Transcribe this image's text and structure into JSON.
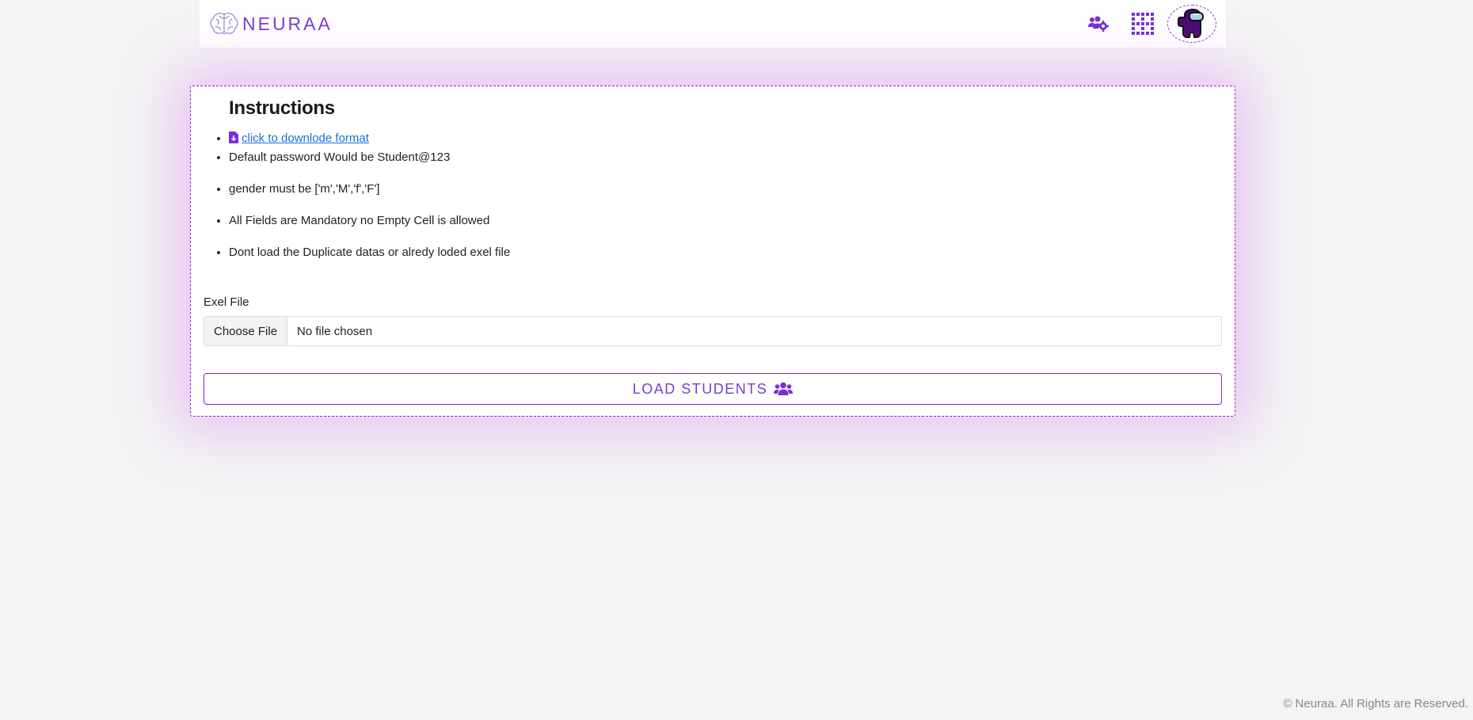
{
  "header": {
    "brand": "NEURAA",
    "icons": {
      "brand": "brain-icon",
      "team_settings": "users-cog-icon",
      "apps": "grid-icon",
      "avatar": "avatar-icon"
    },
    "accent_color": "#7a3ecb"
  },
  "instructions": {
    "title": "Instructions",
    "download_link": "click to downlode format",
    "items": [
      "Default password Would be Student@123",
      "gender must be ['m','M','f','F']",
      "All Fields are Mandatory no Empty Cell is allowed",
      "Dont load the Duplicate datas or alredy loded exel file"
    ]
  },
  "form": {
    "file_label": "Exel File",
    "choose_file": "Choose File",
    "file_status": "No file chosen",
    "submit_label": "LOAD STUDENTS"
  },
  "footer": {
    "copyright": "© Neuraa. All Rights are Reserved."
  }
}
